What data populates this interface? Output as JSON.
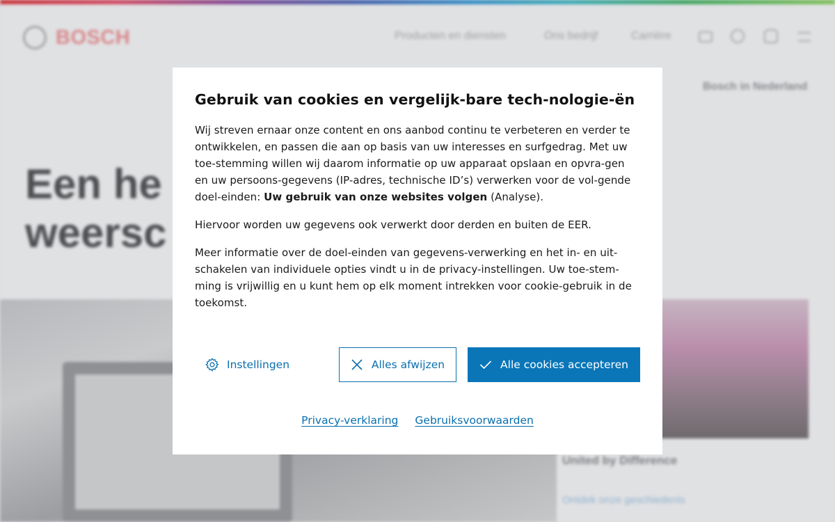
{
  "background": {
    "logo_text": "BOSCH",
    "nav_items": [
      "Producten en diensten",
      "Ons bedrijf",
      "Carrière"
    ],
    "locale_label": "Bosch in Nederland",
    "hero_line1": "Een he",
    "hero_line2": "weersc",
    "caption": "United by Difference",
    "link": "Ontdek onze geschiedenis"
  },
  "dialog": {
    "title": "Gebruik van cookies en vergelijk-bare tech-nologie-ën",
    "para1_text": "Wij streven ernaar onze content en ons aanbod continu te verbeteren en verder te ontwikkelen, en passen die aan op basis van uw interesses en surfgedrag. Met uw toe-stemming willen wij daarom informatie op uw apparaat opslaan en opvra-gen en uw persoons-gegevens (IP-adres, technische ID’s) verwerken voor de vol-gende doel-einden: ",
    "para1_bold": "Uw gebruik van onze websites volgen",
    "para1_suffix": " (Analyse).",
    "para2": "Hiervoor worden uw gegevens ook verwerkt door derden en buiten de EER.",
    "para3": "Meer informatie over de doel-einden van gegevens-verwerking en het in- en uit-schakelen van individuele opties vindt u in de privacy-instellingen. Uw toe-stem-ming is vrijwillig en u kunt hem op elk moment intrekken voor cookie-gebruik in de toekomst.",
    "buttons": {
      "settings": "Instellingen",
      "reject": "Alles afwijzen",
      "accept": "Alle cookies accepteren"
    },
    "links": {
      "privacy": "Privacy-verklaring",
      "terms": "Gebruiksvoorwaarden"
    }
  },
  "colors": {
    "accent": "#0a6fae",
    "accept_bg": "#0a76b8"
  },
  "icons": {
    "settings": "gear-icon",
    "reject": "close-icon",
    "accept": "checkmark-icon"
  }
}
